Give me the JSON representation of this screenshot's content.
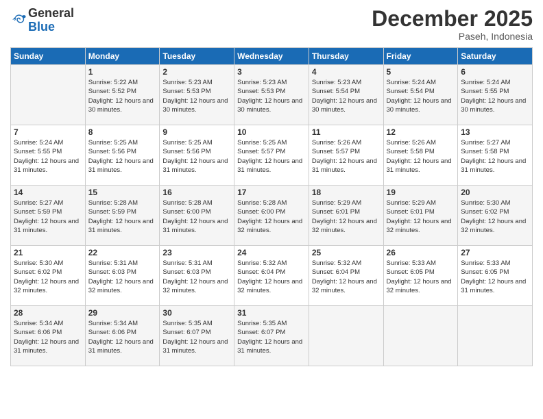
{
  "header": {
    "logo_general": "General",
    "logo_blue": "Blue",
    "month_title": "December 2025",
    "location": "Paseh, Indonesia"
  },
  "days_of_week": [
    "Sunday",
    "Monday",
    "Tuesday",
    "Wednesday",
    "Thursday",
    "Friday",
    "Saturday"
  ],
  "weeks": [
    [
      {
        "day": "",
        "info": ""
      },
      {
        "day": "1",
        "info": "Sunrise: 5:22 AM\nSunset: 5:52 PM\nDaylight: 12 hours\nand 30 minutes."
      },
      {
        "day": "2",
        "info": "Sunrise: 5:23 AM\nSunset: 5:53 PM\nDaylight: 12 hours\nand 30 minutes."
      },
      {
        "day": "3",
        "info": "Sunrise: 5:23 AM\nSunset: 5:53 PM\nDaylight: 12 hours\nand 30 minutes."
      },
      {
        "day": "4",
        "info": "Sunrise: 5:23 AM\nSunset: 5:54 PM\nDaylight: 12 hours\nand 30 minutes."
      },
      {
        "day": "5",
        "info": "Sunrise: 5:24 AM\nSunset: 5:54 PM\nDaylight: 12 hours\nand 30 minutes."
      },
      {
        "day": "6",
        "info": "Sunrise: 5:24 AM\nSunset: 5:55 PM\nDaylight: 12 hours\nand 30 minutes."
      }
    ],
    [
      {
        "day": "7",
        "info": "Sunrise: 5:24 AM\nSunset: 5:55 PM\nDaylight: 12 hours\nand 31 minutes."
      },
      {
        "day": "8",
        "info": "Sunrise: 5:25 AM\nSunset: 5:56 PM\nDaylight: 12 hours\nand 31 minutes."
      },
      {
        "day": "9",
        "info": "Sunrise: 5:25 AM\nSunset: 5:56 PM\nDaylight: 12 hours\nand 31 minutes."
      },
      {
        "day": "10",
        "info": "Sunrise: 5:25 AM\nSunset: 5:57 PM\nDaylight: 12 hours\nand 31 minutes."
      },
      {
        "day": "11",
        "info": "Sunrise: 5:26 AM\nSunset: 5:57 PM\nDaylight: 12 hours\nand 31 minutes."
      },
      {
        "day": "12",
        "info": "Sunrise: 5:26 AM\nSunset: 5:58 PM\nDaylight: 12 hours\nand 31 minutes."
      },
      {
        "day": "13",
        "info": "Sunrise: 5:27 AM\nSunset: 5:58 PM\nDaylight: 12 hours\nand 31 minutes."
      }
    ],
    [
      {
        "day": "14",
        "info": "Sunrise: 5:27 AM\nSunset: 5:59 PM\nDaylight: 12 hours\nand 31 minutes."
      },
      {
        "day": "15",
        "info": "Sunrise: 5:28 AM\nSunset: 5:59 PM\nDaylight: 12 hours\nand 31 minutes."
      },
      {
        "day": "16",
        "info": "Sunrise: 5:28 AM\nSunset: 6:00 PM\nDaylight: 12 hours\nand 31 minutes."
      },
      {
        "day": "17",
        "info": "Sunrise: 5:28 AM\nSunset: 6:00 PM\nDaylight: 12 hours\nand 32 minutes."
      },
      {
        "day": "18",
        "info": "Sunrise: 5:29 AM\nSunset: 6:01 PM\nDaylight: 12 hours\nand 32 minutes."
      },
      {
        "day": "19",
        "info": "Sunrise: 5:29 AM\nSunset: 6:01 PM\nDaylight: 12 hours\nand 32 minutes."
      },
      {
        "day": "20",
        "info": "Sunrise: 5:30 AM\nSunset: 6:02 PM\nDaylight: 12 hours\nand 32 minutes."
      }
    ],
    [
      {
        "day": "21",
        "info": "Sunrise: 5:30 AM\nSunset: 6:02 PM\nDaylight: 12 hours\nand 32 minutes."
      },
      {
        "day": "22",
        "info": "Sunrise: 5:31 AM\nSunset: 6:03 PM\nDaylight: 12 hours\nand 32 minutes."
      },
      {
        "day": "23",
        "info": "Sunrise: 5:31 AM\nSunset: 6:03 PM\nDaylight: 12 hours\nand 32 minutes."
      },
      {
        "day": "24",
        "info": "Sunrise: 5:32 AM\nSunset: 6:04 PM\nDaylight: 12 hours\nand 32 minutes."
      },
      {
        "day": "25",
        "info": "Sunrise: 5:32 AM\nSunset: 6:04 PM\nDaylight: 12 hours\nand 32 minutes."
      },
      {
        "day": "26",
        "info": "Sunrise: 5:33 AM\nSunset: 6:05 PM\nDaylight: 12 hours\nand 32 minutes."
      },
      {
        "day": "27",
        "info": "Sunrise: 5:33 AM\nSunset: 6:05 PM\nDaylight: 12 hours\nand 31 minutes."
      }
    ],
    [
      {
        "day": "28",
        "info": "Sunrise: 5:34 AM\nSunset: 6:06 PM\nDaylight: 12 hours\nand 31 minutes."
      },
      {
        "day": "29",
        "info": "Sunrise: 5:34 AM\nSunset: 6:06 PM\nDaylight: 12 hours\nand 31 minutes."
      },
      {
        "day": "30",
        "info": "Sunrise: 5:35 AM\nSunset: 6:07 PM\nDaylight: 12 hours\nand 31 minutes."
      },
      {
        "day": "31",
        "info": "Sunrise: 5:35 AM\nSunset: 6:07 PM\nDaylight: 12 hours\nand 31 minutes."
      },
      {
        "day": "",
        "info": ""
      },
      {
        "day": "",
        "info": ""
      },
      {
        "day": "",
        "info": ""
      }
    ]
  ]
}
